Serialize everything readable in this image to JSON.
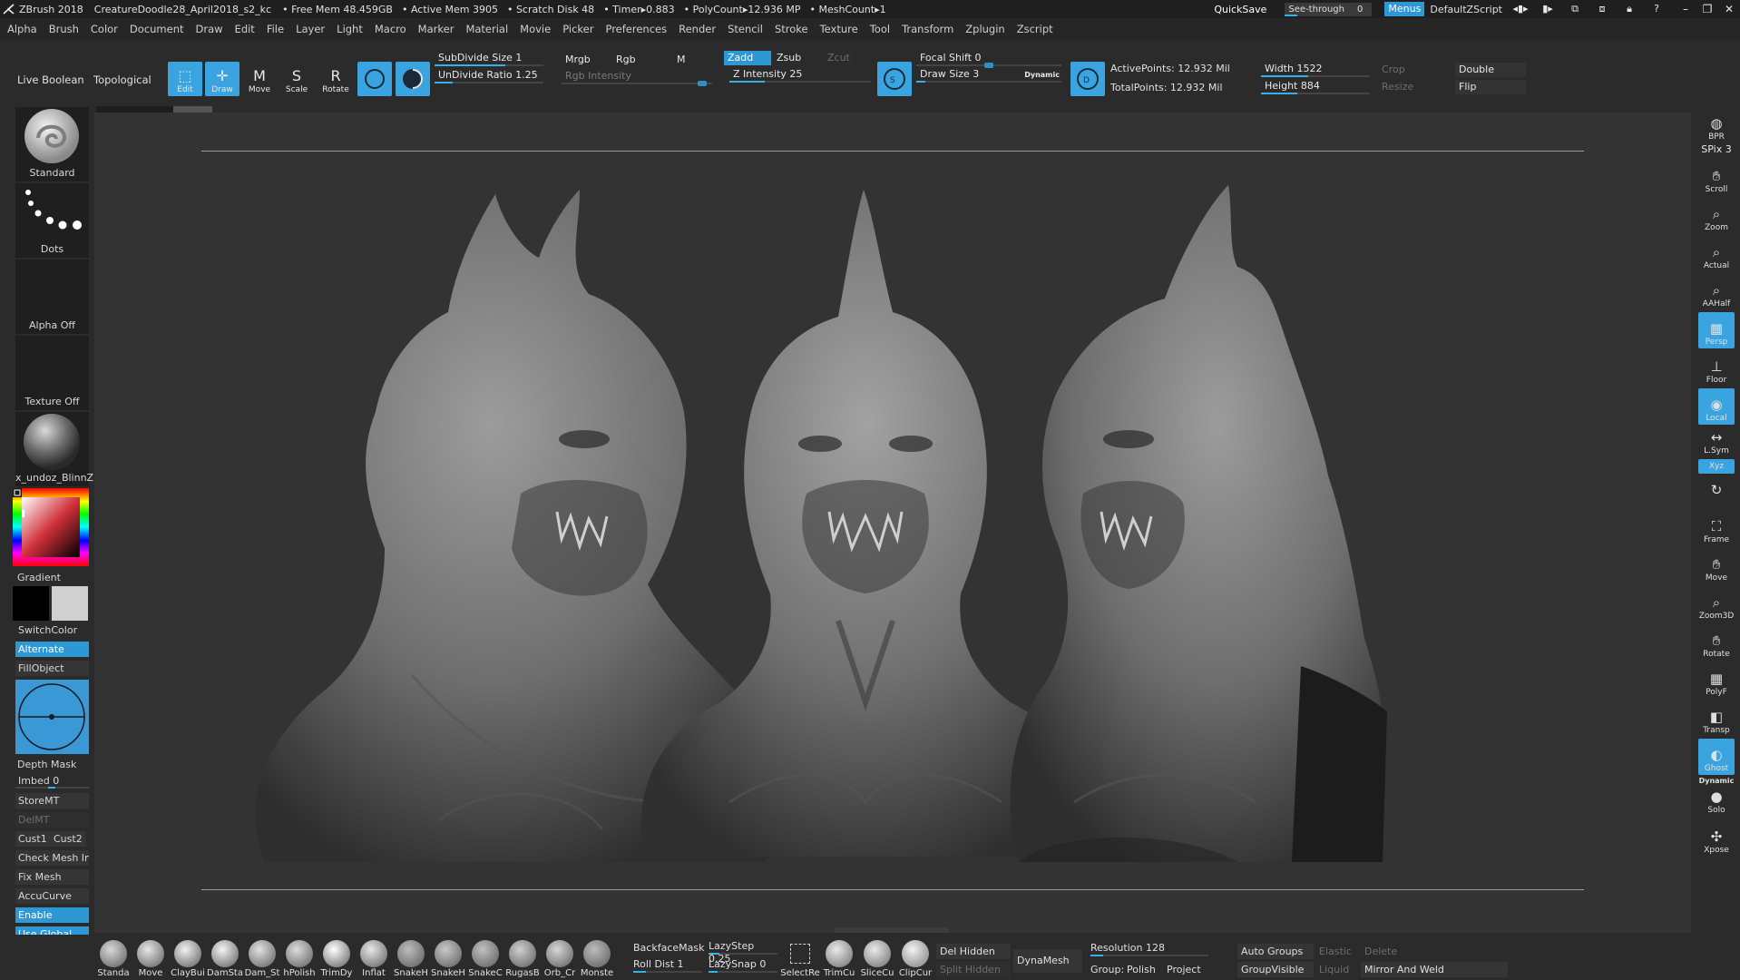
{
  "titlebar": {
    "app": "ZBrush 2018",
    "document": "CreatureDoodle28_April2018_s2_kc",
    "free_mem": "• Free Mem 48.459GB",
    "active_mem": "• Active Mem 3905",
    "scratch": "• Scratch Disk 48",
    "timer": "• Timer▸0.883",
    "polycount": "• PolyCount▸12.936 MP",
    "meshcount": "• MeshCount▸1",
    "quicksave": "QuickSave",
    "see_through_label": "See-through",
    "see_through_value": "0",
    "menus": "Menus",
    "default_zscript": "DefaultZScript"
  },
  "menubar": [
    "Alpha",
    "Brush",
    "Color",
    "Document",
    "Draw",
    "Edit",
    "File",
    "Layer",
    "Light",
    "Macro",
    "Marker",
    "Material",
    "Movie",
    "Picker",
    "Preferences",
    "Render",
    "Stencil",
    "Stroke",
    "Texture",
    "Tool",
    "Transform",
    "Zplugin",
    "Zscript"
  ],
  "shelf": {
    "live_boolean": "Live Boolean",
    "topological": "Topological",
    "edit": "Edit",
    "draw": "Draw",
    "move": "Move",
    "scale": "Scale",
    "rotate": "Rotate",
    "subdivide_size": "SubDivide Size 1",
    "undivide_ratio": "UnDivide Ratio 1.25",
    "mrgb": "Mrgb",
    "rgb": "Rgb",
    "m": "M",
    "rgb_intensity": "Rgb Intensity",
    "zadd": "Zadd",
    "zsub": "Zsub",
    "zcut": "Zcut",
    "z_intensity": "Z Intensity 25",
    "focal_shift": "Focal Shift 0",
    "draw_size": "Draw Size 3",
    "dynamic": "Dynamic",
    "active_points": "ActivePoints: 12.932 Mil",
    "total_points": "TotalPoints: 12.932 Mil",
    "width": "Width 1522",
    "height": "Height 884",
    "crop": "Crop",
    "resize": "Resize",
    "double": "Double",
    "flip": "Flip",
    "z_intensity_value": 25,
    "draw_size_value": 3,
    "focal_shift_value": 0
  },
  "lefttray": {
    "standard": "Standard",
    "dots": "Dots",
    "alpha_off": "Alpha Off",
    "texture_off": "Texture Off",
    "material": "x_undoz_BlinnZ",
    "gradient": "Gradient",
    "switch_color": "SwitchColor",
    "alternate": "Alternate",
    "fill_object": "FillObject",
    "depth_mask": "Depth Mask",
    "imbed": "Imbed 0",
    "store_mt": "StoreMT",
    "del_mt": "DelMT",
    "cust1": "Cust1",
    "cust2": "Cust2",
    "check_mesh": "Check Mesh In",
    "fix_mesh": "Fix Mesh",
    "accucurve": "AccuCurve",
    "enable": "Enable",
    "use_global": "Use Global"
  },
  "rightshelf": {
    "bpr": "BPR",
    "spix": "SPix 3",
    "scroll": "Scroll",
    "zoom": "Zoom",
    "actual": "Actual",
    "aahalf": "AAHalf",
    "persp": "Persp",
    "floor": "Floor",
    "local": "Local",
    "lsym": "L.Sym",
    "xyz": "Xyz",
    "frame": "Frame",
    "move": "Move",
    "zoom3d": "Zoom3D",
    "rotate": "Rotate",
    "polyf": "PolyF",
    "transp": "Transp",
    "ghost": "Ghost",
    "dynamic": "Dynamic",
    "solo": "Solo",
    "xpose": "Xpose"
  },
  "bottomshelf": {
    "brushes": [
      "Standa",
      "Move",
      "ClayBui",
      "DamSta",
      "Dam_St",
      "hPolish",
      "TrimDy",
      "Inflat",
      "SnakeH",
      "SnakeH",
      "SnakeC",
      "RugasB",
      "Orb_Cr",
      "Monste"
    ],
    "backface_mask": "BackfaceMask",
    "lazy_step": "LazyStep 0.25",
    "roll_dist": "Roll Dist 1",
    "lazy_snap": "LazySnap 0",
    "select_rect": "SelectRe",
    "trim_curve": "TrimCu",
    "slice_curve": "SliceCu",
    "clip_curve": "ClipCur",
    "del_hidden": "Del Hidden",
    "split_hidden": "Split Hidden",
    "dynamesh": "DynaMesh",
    "resolution": "Resolution 128",
    "group": "Group:",
    "polish": "Polish",
    "project": "Project",
    "auto_groups": "Auto Groups",
    "elastic": "Elastic",
    "delete": "Delete",
    "group_visible": "GroupVisible",
    "liquid": "Liquid",
    "mirror_and_weld": "Mirror And Weld"
  },
  "colors": {
    "accent": "#3aa4e0",
    "background": "#2b2b2b",
    "canvas": "#333333",
    "main_color": "#000000",
    "secondary_color": "#d0d0d0"
  }
}
